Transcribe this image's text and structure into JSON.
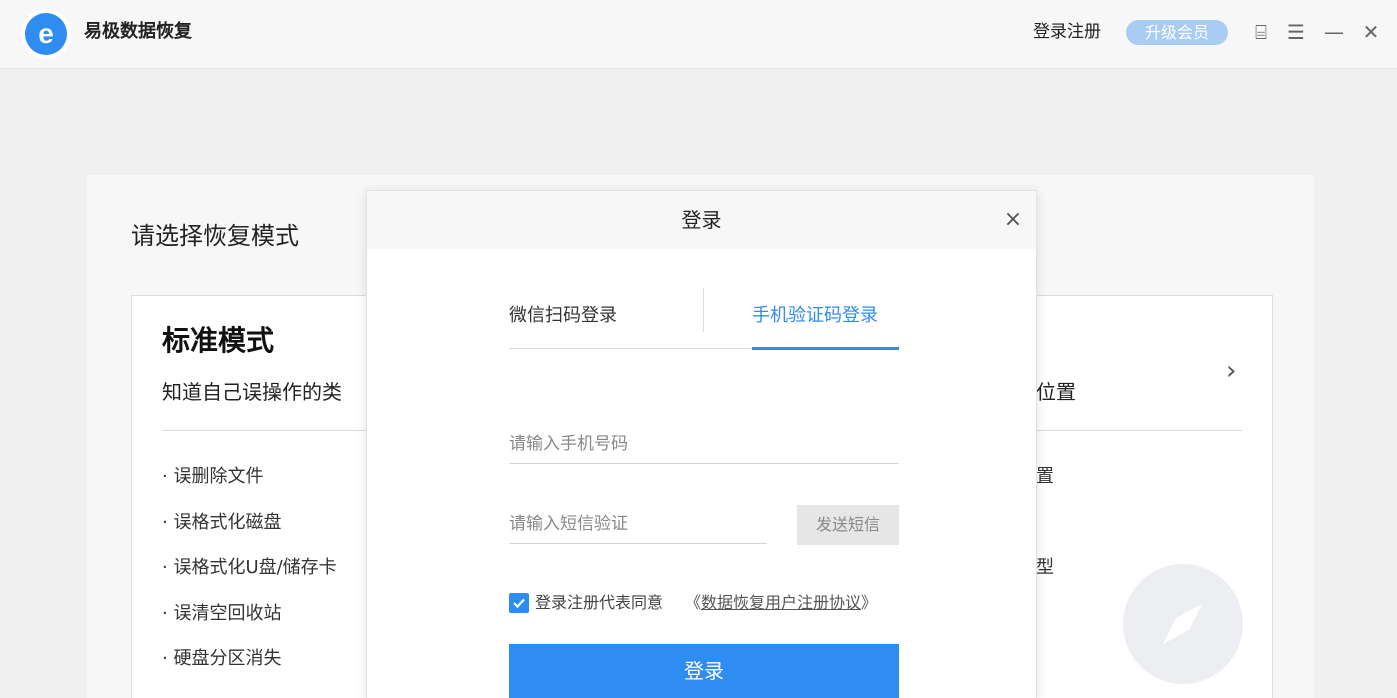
{
  "app": {
    "title": "易极数据恢复",
    "logo_letter": "e"
  },
  "header": {
    "login_register": "登录注册",
    "upgrade_member": "升级会员",
    "icons": [
      "feedback-icon",
      "menu-icon",
      "minimize-icon",
      "close-icon"
    ],
    "feedback_glyph": "⌸",
    "menu_glyph": "☰",
    "minimize_glyph": "—",
    "close_glyph": "✕"
  },
  "main": {
    "section_title": "请选择恢复模式",
    "mode": {
      "name": "标准模式",
      "description_left": "知道自己误操作的类",
      "description_right": "位置",
      "chevron": "›",
      "scenarios": [
        "· 误删除文件",
        "· 误格式化磁盘",
        "· 误格式化U盘/储存卡",
        "· 误清空回收站",
        "· 硬盘分区消失"
      ],
      "scenarios_right": [
        "置",
        "型"
      ]
    }
  },
  "dialog": {
    "title": "登录",
    "close_glyph": "×",
    "tabs": [
      {
        "label": "微信扫码登录",
        "active": false
      },
      {
        "label": "手机验证码登录",
        "active": true
      }
    ],
    "phone_placeholder": "请输入手机号码",
    "code_placeholder": "请输入短信验证",
    "send_sms": "发送短信",
    "agree_checked": true,
    "agree_text": "登录注册代表同意",
    "agree_link_open": "《",
    "agree_link": "数据恢复用户注册协议",
    "agree_link_close": "》",
    "login_button": "登录"
  },
  "colors": {
    "accent": "#2f8cf0",
    "upgrade_badge": "#a9ccf3"
  }
}
